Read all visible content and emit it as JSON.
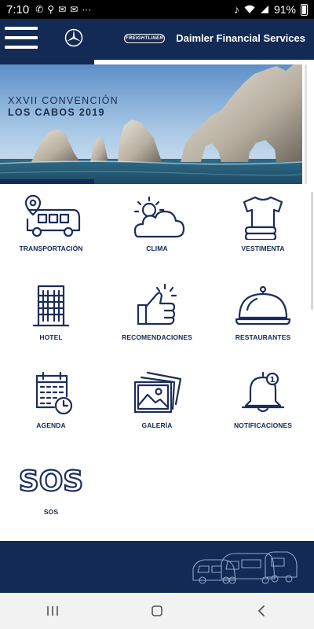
{
  "status_bar": {
    "time": "7:10",
    "battery_text": "91%",
    "icons": [
      "call-icon",
      "usb-icon",
      "email-icon",
      "email-icon",
      "more-icon",
      "mute-icon",
      "wifi-icon",
      "signal-icon",
      "battery-icon"
    ]
  },
  "app_bar": {
    "title": "Daimler Financial Services",
    "brand_logo": "FREIGHTLINER"
  },
  "banner": {
    "line1": "XXVII CONVENCIÓN",
    "line2": "LOS CABOS 2019"
  },
  "menu": {
    "transportacion": "TRANSPORTACIÓN",
    "clima": "CLIMA",
    "vestimenta": "VESTIMENTA",
    "hotel": "HOTEL",
    "recomendaciones": "RECOMENDACIONES",
    "restaurantes": "RESTAURANTES",
    "agenda": "AGENDA",
    "galeria": "GALERÍA",
    "notificaciones": "NOTIFICACIONES",
    "sos": "SOS",
    "sos_icon_text": "SOS",
    "notification_count": "1"
  },
  "colors": {
    "brand_navy": "#122a54",
    "icon_navy": "#1d2d5b",
    "background": "#ffffff"
  }
}
